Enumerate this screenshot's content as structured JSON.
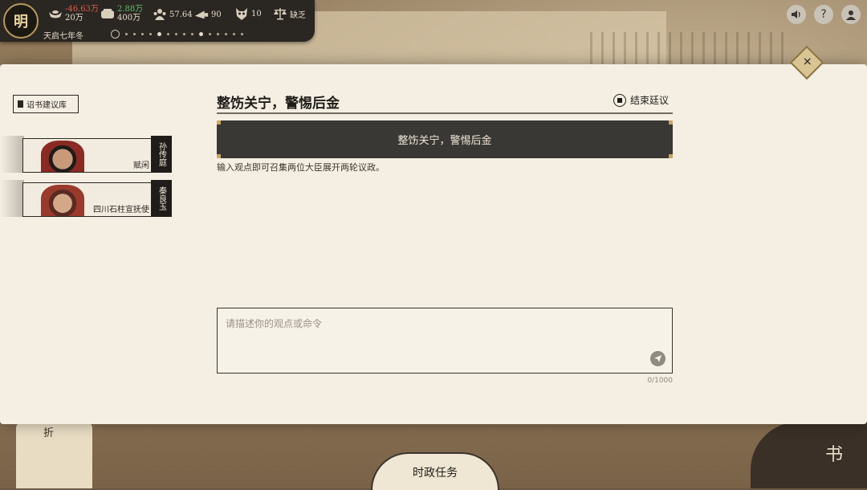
{
  "status": {
    "dynasty": "明",
    "treasury": {
      "change": "-46.63万",
      "total": "20万"
    },
    "grain": {
      "change": "2.88万",
      "total": "400万"
    },
    "stat_a": "57.64",
    "stat_b": "90",
    "stat_c": "10",
    "balance": "缺乏",
    "date": "天启七年冬"
  },
  "top_icons": [
    "speaker-icon",
    "help-icon",
    "profile-icon"
  ],
  "help_glyph": "?",
  "sidebar": {
    "library_label": "诏书建议库",
    "ministers": [
      {
        "name": "孙传庭",
        "title": "赋闲"
      },
      {
        "name": "秦良玉",
        "title": "四川石柱宣抚使"
      }
    ]
  },
  "main": {
    "title": "整饬关宁，警惕后金",
    "end_label": "结束廷议",
    "banner": "整饬关宁，警惕后金",
    "hint": "输入观点即可召集两位大臣展开两轮议政。",
    "input_placeholder": "请描述你的观点或命令",
    "counter": "0/1000"
  },
  "background": {
    "scroll_label": "折",
    "book_label": "书"
  },
  "bottom_tab": "时政任务",
  "colors": {
    "negative": "#e35a4e",
    "positive": "#5dbb6a",
    "banner": "#3a3835",
    "paper": "#f5efe3"
  }
}
